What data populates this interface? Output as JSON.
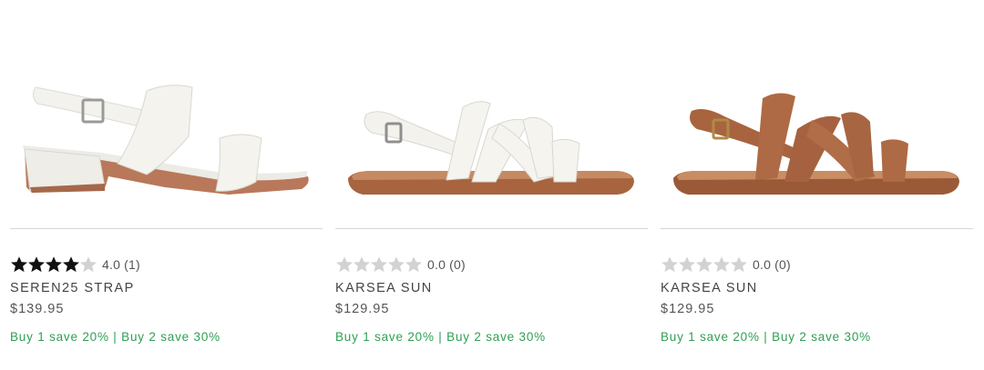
{
  "colors": {
    "promo_green": "#2e9f52",
    "star_filled": "#111111",
    "star_empty": "#d2d2d2",
    "divider": "#d6d6d6",
    "leather_white": "#f2f1ec",
    "leather_tan": "#a8643f"
  },
  "products": [
    {
      "name": "SEREN25 STRAP",
      "price": "$139.95",
      "rating_value": 4,
      "rating_text": "4.0 (1)",
      "promo": "Buy 1 save 20% | Buy 2 save 30%",
      "image_icon": "white-block-heel-sandal"
    },
    {
      "name": "KARSEA SUN",
      "price": "$129.95",
      "rating_value": 0,
      "rating_text": "0.0 (0)",
      "promo": "Buy 1 save 20% | Buy 2 save 30%",
      "image_icon": "white-strappy-flat-sandal"
    },
    {
      "name": "KARSEA SUN",
      "price": "$129.95",
      "rating_value": 0,
      "rating_text": "0.0 (0)",
      "promo": "Buy 1 save 20% | Buy 2 save 30%",
      "image_icon": "tan-strappy-flat-sandal"
    }
  ]
}
